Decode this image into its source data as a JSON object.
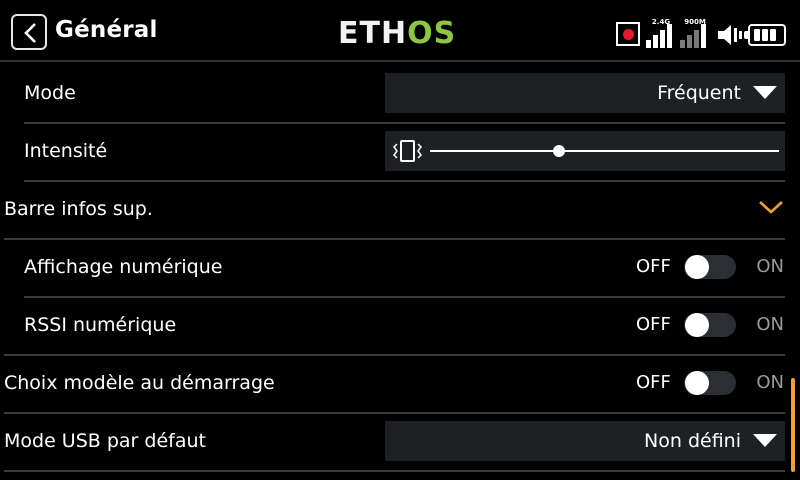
{
  "header": {
    "title": "Général",
    "logo": {
      "part1": "ETH",
      "part2": "OS"
    },
    "status": {
      "sig1_label": "2.4G",
      "sig2_label": "900M"
    },
    "colors": {
      "logo_accent": "#8dc63f",
      "record": "#e8192c",
      "scrollbar": "#f0a030",
      "chevron": "#f0a030"
    }
  },
  "settings": {
    "mode": {
      "label": "Mode",
      "value": "Fréquent"
    },
    "intensity": {
      "label": "Intensité",
      "level": 0.37
    },
    "infobar": {
      "label": "Barre infos sup."
    },
    "numeric_display": {
      "label": "Affichage numérique",
      "off": "OFF",
      "on": "ON",
      "state": "off"
    },
    "rssi_numeric": {
      "label": "RSSI numérique",
      "off": "OFF",
      "on": "ON",
      "state": "off"
    },
    "model_choice": {
      "label": "Choix modèle au démarrage",
      "off": "OFF",
      "on": "ON",
      "state": "off"
    },
    "usb_mode": {
      "label": "Mode USB par défaut",
      "value": "Non défini"
    }
  }
}
